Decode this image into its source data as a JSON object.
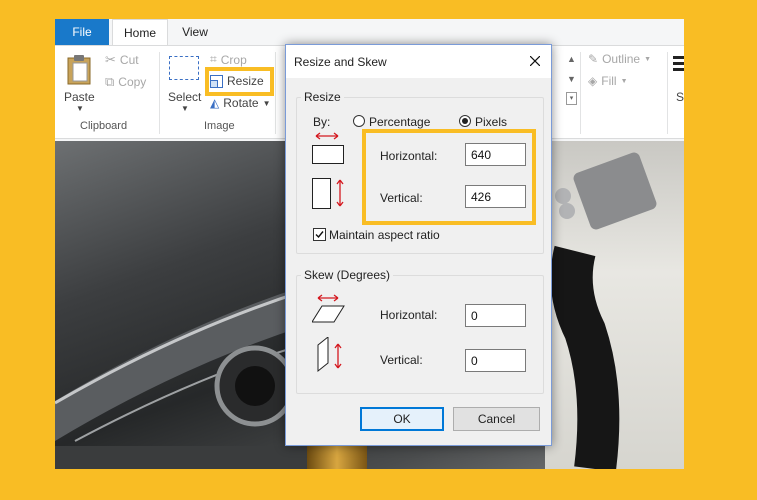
{
  "ribbon": {
    "tabs": {
      "file": "File",
      "home": "Home",
      "view": "View"
    },
    "clipboard": {
      "paste": "Paste",
      "cut": "Cut",
      "copy": "Copy",
      "group": "Clipboard"
    },
    "image": {
      "select": "Select",
      "crop": "Crop",
      "resize": "Resize",
      "rotate": "Rotate",
      "group": "Image"
    },
    "shapes": {
      "outline": "Outline",
      "fill": "Fill",
      "size_partial": "S"
    }
  },
  "dialog": {
    "title": "Resize and Skew",
    "resize": {
      "legend": "Resize",
      "by_label": "By:",
      "percentage_label": "Percentage",
      "pixels_label": "Pixels",
      "selected_unit": "Pixels",
      "horizontal_label": "Horizontal:",
      "horizontal_value": "640",
      "vertical_label": "Vertical:",
      "vertical_value": "426",
      "aspect_label": "Maintain aspect ratio",
      "aspect_checked": true
    },
    "skew": {
      "legend": "Skew (Degrees)",
      "horizontal_label": "Horizontal:",
      "horizontal_value": "0",
      "vertical_label": "Vertical:",
      "vertical_value": "0"
    },
    "ok_label": "OK",
    "cancel_label": "Cancel"
  },
  "colors": {
    "highlight": "#f9bd24",
    "file_tab": "#1979ca",
    "arrow_red": "#d4181f"
  }
}
